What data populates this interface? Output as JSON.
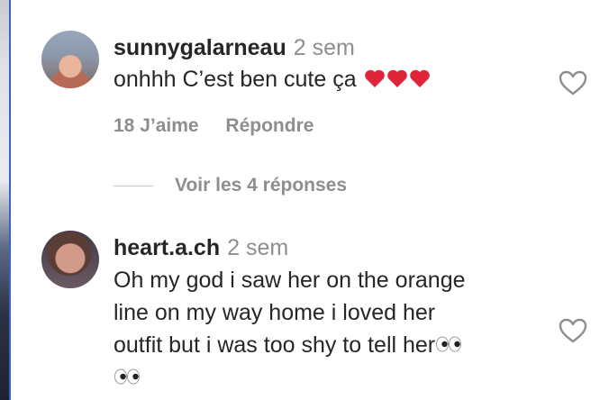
{
  "comments": [
    {
      "username": "sunnygalarneau",
      "time": "2 sem",
      "text": "onhhh C’est ben cute ça",
      "emoji": "red-heart x3",
      "likes_label": "18 J’aime",
      "reply_label": "Répondre",
      "view_replies_label": "Voir les 4 réponses"
    },
    {
      "username": "heart.a.ch",
      "time": "2 sem",
      "text_lines": [
        "Oh my god i saw her on the orange",
        "line on my way home i loved her",
        "outfit but i was too shy to tell her"
      ],
      "emoji": "eyes x2"
    }
  ],
  "colors": {
    "username": "#262626",
    "secondary": "#8e8e8e",
    "heart_emoji": "#e0243a",
    "divider": "#c7c7c7"
  },
  "icons": [
    "heart-outline-icon",
    "red-heart-emoji",
    "eyes-emoji"
  ]
}
